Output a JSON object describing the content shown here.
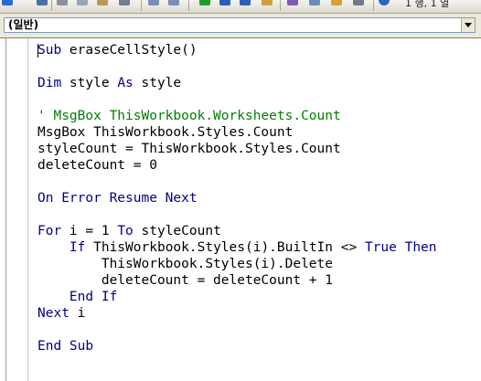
{
  "toolbar": {
    "status": "1 행, 1 열"
  },
  "procedure_bar": {
    "selected": "(일반)"
  },
  "code": {
    "lines": [
      [
        {
          "t": "Sub",
          "k": "kw"
        },
        {
          "t": " eraseCellStyle()",
          "k": ""
        }
      ],
      [],
      [
        {
          "t": "Dim",
          "k": "kw"
        },
        {
          "t": " style ",
          "k": ""
        },
        {
          "t": "As",
          "k": "kw"
        },
        {
          "t": " style",
          "k": ""
        }
      ],
      [],
      [
        {
          "t": "' MsgBox ThisWorkbook.Worksheets.Count",
          "k": "cm"
        }
      ],
      [
        {
          "t": "MsgBox ThisWorkbook.Styles.Count",
          "k": ""
        }
      ],
      [
        {
          "t": "styleCount = ThisWorkbook.Styles.Count",
          "k": ""
        }
      ],
      [
        {
          "t": "deleteCount = 0",
          "k": ""
        }
      ],
      [],
      [
        {
          "t": "On Error Resume Next",
          "k": "kw"
        }
      ],
      [],
      [
        {
          "t": "For",
          "k": "kw"
        },
        {
          "t": " i = 1 ",
          "k": ""
        },
        {
          "t": "To",
          "k": "kw"
        },
        {
          "t": " styleCount",
          "k": ""
        }
      ],
      [
        {
          "t": "    ",
          "k": ""
        },
        {
          "t": "If",
          "k": "kw"
        },
        {
          "t": " ThisWorkbook.Styles(i).BuiltIn <> ",
          "k": ""
        },
        {
          "t": "True",
          "k": "kw"
        },
        {
          "t": " ",
          "k": ""
        },
        {
          "t": "Then",
          "k": "kw"
        }
      ],
      [
        {
          "t": "        ThisWorkbook.Styles(i).Delete",
          "k": ""
        }
      ],
      [
        {
          "t": "        deleteCount = deleteCount + 1",
          "k": ""
        }
      ],
      [
        {
          "t": "    ",
          "k": ""
        },
        {
          "t": "End If",
          "k": "kw"
        }
      ],
      [
        {
          "t": "Next",
          "k": "kw"
        },
        {
          "t": " i",
          "k": ""
        }
      ],
      [],
      [
        {
          "t": "End Sub",
          "k": "kw"
        }
      ]
    ]
  }
}
